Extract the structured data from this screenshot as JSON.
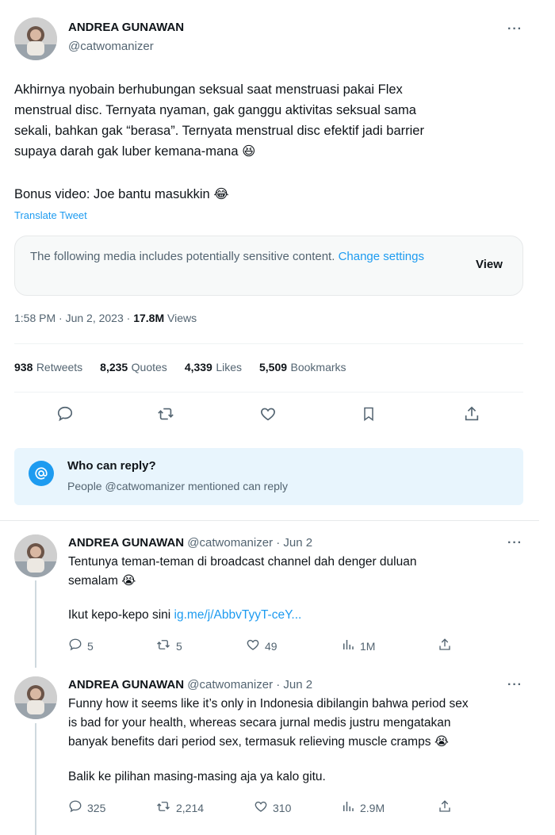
{
  "main": {
    "author_name": "ANDREA GUNAWAN",
    "author_handle": "@catwomanizer",
    "more": "···",
    "text": "Akhirnya nyobain berhubungan seksual saat menstruasi pakai Flex\nmenstrual disc. Ternyata nyaman, gak ganggu aktivitas seksual sama\nsekali, bahkan gak “berasa”. Ternyata menstrual disc efektif jadi barrier\nsupaya darah gak luber kemana-mana 😆",
    "bonus": "Bonus video: Joe bantu masukkin 😂",
    "translate": "Translate Tweet",
    "sensitive_text": "The following media includes potentially sensitive content. ",
    "sensitive_link": "Change settings",
    "view_label": "View",
    "timestamp": "1:58 PM · Jun 2, 2023 · ",
    "views_count": "17.8M",
    "views_label": " Views",
    "stats": [
      {
        "num": "938",
        "label": "Retweets"
      },
      {
        "num": "8,235",
        "label": "Quotes"
      },
      {
        "num": "4,339",
        "label": "Likes"
      },
      {
        "num": "5,509",
        "label": "Bookmarks"
      }
    ],
    "who_title": "Who can reply?",
    "who_sub": "People @catwomanizer mentioned can reply"
  },
  "replies": [
    {
      "name": "ANDREA GUNAWAN",
      "handle_date": "@catwomanizer · Jun 2",
      "text": "Tentunya teman-teman di broadcast channel dah denger duluan\nsemalam 😭",
      "text2": "Ikut kepo-kepo sini ",
      "link": "ig.me/j/AbbvTyyT-ceY...",
      "replies": "5",
      "retweets": "5",
      "likes": "49",
      "views": "1M"
    },
    {
      "name": "ANDREA GUNAWAN",
      "handle_date": "@catwomanizer · Jun 2",
      "text": "Funny how it seems like it’s only in Indonesia dibilangin bahwa period sex\nis bad for your health, whereas secara jurnal medis justru mengatakan\nbanyak benefits dari period sex, termasuk relieving muscle cramps 😭",
      "text2": "Balik ke pilihan masing-masing aja ya kalo gitu.",
      "replies": "325",
      "retweets": "2,214",
      "likes": "310",
      "views": "2.9M"
    }
  ],
  "icons": [
    "reply-icon",
    "retweet-icon",
    "like-icon",
    "bookmark-icon",
    "share-icon",
    "views-icon",
    "at-icon"
  ],
  "colors": {
    "accent": "#1d9bf0",
    "muted": "#536471",
    "who_bg": "#e8f5fd"
  }
}
